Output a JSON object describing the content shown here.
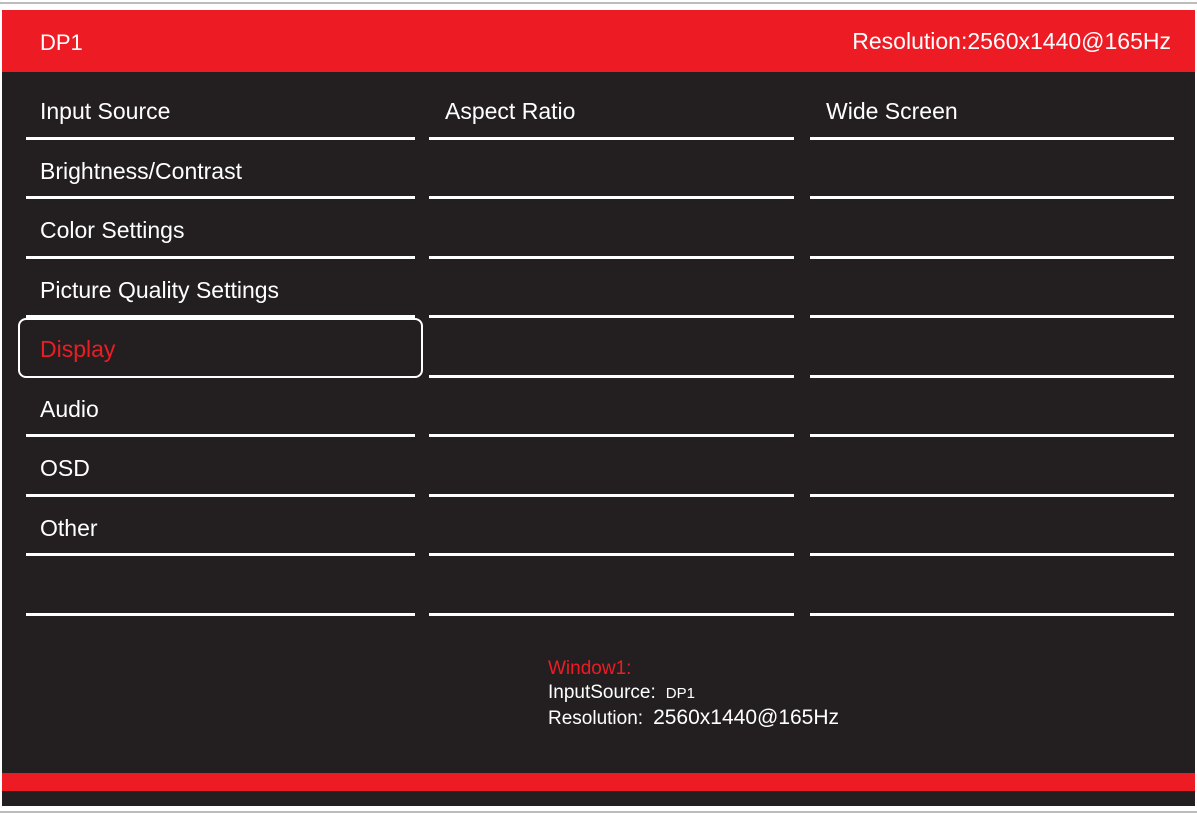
{
  "header": {
    "source": "DP1",
    "resolution": "Resolution:2560x1440@165Hz"
  },
  "menu": {
    "items": [
      {
        "label": "Input Source"
      },
      {
        "label": "Brightness/Contrast"
      },
      {
        "label": "Color Settings"
      },
      {
        "label": "Picture Quality Settings"
      },
      {
        "label": "Display"
      },
      {
        "label": "Audio"
      },
      {
        "label": "OSD"
      },
      {
        "label": "Other"
      },
      {
        "label": ""
      }
    ],
    "selected": "Display"
  },
  "submenu": {
    "items": [
      "Aspect Ratio",
      "",
      "",
      "",
      "",
      "",
      "",
      "",
      ""
    ]
  },
  "options": {
    "items": [
      "Wide Screen",
      "",
      "",
      "",
      "",
      "",
      "",
      "",
      ""
    ]
  },
  "info": {
    "title": "Window1:",
    "input_label": "InputSource:",
    "input_value": "DP1",
    "resolution_label": "Resolution:",
    "resolution_value": "2560x1440@165Hz"
  },
  "colors": {
    "accent": "#ed1c24",
    "background": "#231f20",
    "text": "#ffffff"
  }
}
